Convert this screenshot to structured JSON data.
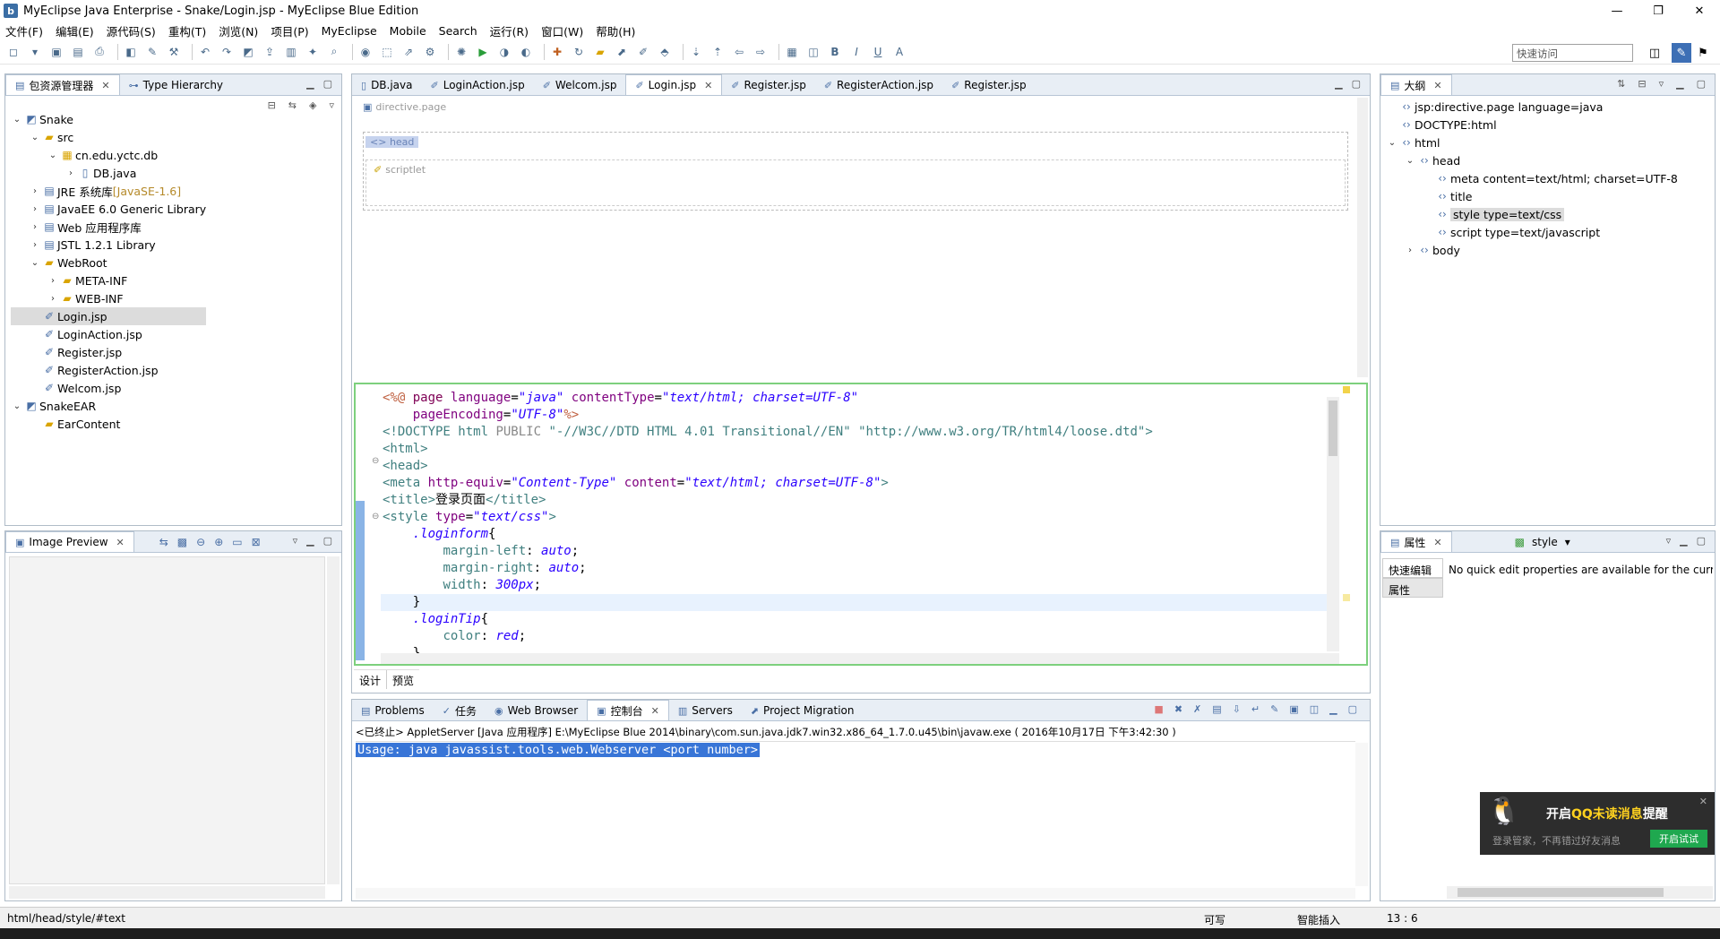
{
  "window": {
    "title": "MyEclipse Java Enterprise  -  Snake/Login.jsp  -  MyEclipse Blue Edition",
    "controls": [
      "—",
      "❐",
      "✕"
    ]
  },
  "menu": [
    "文件(F)",
    "编辑(E)",
    "源代码(S)",
    "重构(T)",
    "浏览(N)",
    "项目(P)",
    "MyEclipse",
    "Mobile",
    "Search",
    "运行(R)",
    "窗口(W)",
    "帮助(H)"
  ],
  "quick_access": {
    "value": "快速访问"
  },
  "explorer": {
    "tabs": [
      {
        "label": "包资源管理器"
      },
      {
        "label": "Type Hierarchy"
      }
    ],
    "tree": [
      {
        "label": "Snake",
        "icon": "project-icon",
        "level": 0,
        "tw": "⌄"
      },
      {
        "label": "src",
        "icon": "package-folder-icon",
        "level": 1,
        "tw": "⌄"
      },
      {
        "label": "cn.edu.yctc.db",
        "icon": "package-icon",
        "level": 2,
        "tw": "⌄"
      },
      {
        "label": "DB.java",
        "icon": "java-file-icon",
        "level": 3,
        "tw": "›"
      },
      {
        "label": "JRE 系统库",
        "extra": " [JavaSE-1.6]",
        "icon": "library-icon",
        "level": 1,
        "tw": "›"
      },
      {
        "label": "JavaEE 6.0 Generic Library",
        "icon": "library-icon",
        "level": 1,
        "tw": "›"
      },
      {
        "label": "Web 应用程序库",
        "icon": "library-icon",
        "level": 1,
        "tw": "›"
      },
      {
        "label": "JSTL 1.2.1 Library",
        "icon": "library-icon",
        "level": 1,
        "tw": "›"
      },
      {
        "label": "WebRoot",
        "icon": "folder-icon",
        "level": 1,
        "tw": "⌄"
      },
      {
        "label": "META-INF",
        "icon": "folder-icon",
        "level": 2,
        "tw": "›"
      },
      {
        "label": "WEB-INF",
        "icon": "folder-icon",
        "level": 2,
        "tw": "›"
      },
      {
        "label": "Login.jsp",
        "icon": "jsp-file-icon",
        "level": 1,
        "tw": "",
        "selected": true
      },
      {
        "label": "LoginAction.jsp",
        "icon": "jsp-file-icon",
        "level": 1,
        "tw": ""
      },
      {
        "label": "Register.jsp",
        "icon": "jsp-file-icon",
        "level": 1,
        "tw": ""
      },
      {
        "label": "RegisterAction.jsp",
        "icon": "jsp-file-icon",
        "level": 1,
        "tw": ""
      },
      {
        "label": "Welcom.jsp",
        "icon": "jsp-file-icon",
        "level": 1,
        "tw": ""
      },
      {
        "label": "SnakeEAR",
        "icon": "ear-project-icon",
        "level": 0,
        "tw": "⌄"
      },
      {
        "label": "EarContent",
        "icon": "folder-icon",
        "level": 1,
        "tw": ""
      }
    ]
  },
  "image_preview": {
    "tab": "Image Preview"
  },
  "editor": {
    "tabs": [
      {
        "label": "DB.java"
      },
      {
        "label": "LoginAction.jsp"
      },
      {
        "label": "Welcom.jsp"
      },
      {
        "label": "Login.jsp",
        "active": true
      },
      {
        "label": "Register.jsp"
      },
      {
        "label": "RegisterAction.jsp"
      },
      {
        "label": "Register.jsp"
      }
    ],
    "design": {
      "directive": "directive.page",
      "head": "head",
      "scriptlet": "scriptlet"
    },
    "bottom_tabs": [
      "设计",
      "预览"
    ]
  },
  "outline": {
    "tab": "大纲",
    "items": [
      {
        "label": "jsp:directive.page language=java",
        "level": 0
      },
      {
        "label": "DOCTYPE:html",
        "level": 0
      },
      {
        "label": "html",
        "level": 0,
        "tw": "⌄"
      },
      {
        "label": "head",
        "level": 1,
        "tw": "⌄"
      },
      {
        "label": "meta content=text/html; charset=UTF-8",
        "level": 2
      },
      {
        "label": "title",
        "level": 2
      },
      {
        "label": "style type=text/css",
        "level": 2,
        "selected": true
      },
      {
        "label": "script type=text/javascript",
        "level": 2
      },
      {
        "label": "body",
        "level": 1,
        "tw": "›"
      }
    ]
  },
  "properties": {
    "tab": "属性",
    "selector": "style",
    "side": [
      "快速编辑",
      "属性"
    ],
    "message": "No quick edit properties are available for the curr"
  },
  "console": {
    "tabs": [
      {
        "label": "Problems"
      },
      {
        "label": "任务"
      },
      {
        "label": "Web Browser"
      },
      {
        "label": "控制台",
        "active": true
      },
      {
        "label": "Servers"
      },
      {
        "label": "Project Migration"
      }
    ],
    "header": "<已终止> AppletServer [Java 应用程序] E:\\MyEclipse Blue 2014\\binary\\com.sun.java.jdk7.win32.x86_64_1.7.0.u45\\bin\\javaw.exe ( 2016年10月17日 下午3:42:30 )",
    "output": "Usage: java javassist.tools.web.Webserver <port number>"
  },
  "status": {
    "path": "html/head/style/#text",
    "writable": "可写",
    "insert": "智能插入",
    "position": "13 : 6"
  },
  "qq": {
    "title_pre": "开启",
    "title_hl": "QQ未读消息",
    "title_post": "提醒",
    "sub": "登录管家，不再错过好友消息",
    "button": "开启试试"
  }
}
